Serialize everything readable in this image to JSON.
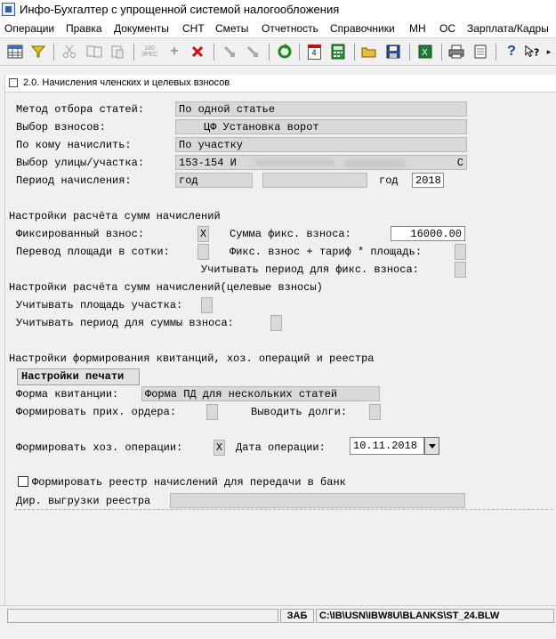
{
  "window": {
    "title": "Инфо-Бухгалтер с упрощенной системой налогообложения"
  },
  "menu": [
    "Операции",
    "Правка",
    "Документы",
    "СНТ",
    "Сметы",
    "Отчетность",
    "Справочники",
    "МН",
    "ОС",
    "Зарплата/Кадры"
  ],
  "toolbar_icons": [
    "grid-icon",
    "filter-icon",
    "cut-icon",
    "copy-icon",
    "paste-icon",
    "calc-icon",
    "add-icon",
    "delete-icon",
    "tool-icon",
    "tool2-icon",
    "refresh-icon",
    "calendar-icon",
    "calculator-icon",
    "open-folder-icon",
    "save-icon",
    "excel-icon",
    "print-icon",
    "preview-icon",
    "help-icon",
    "context-help-icon"
  ],
  "toolbar": {
    "calendar_text": "4",
    "tb_180": "180"
  },
  "form": {
    "header": "2.0. Начисления членских и целевых взносов",
    "method_label": "Метод отбора статей:",
    "method_value": "По одной статье",
    "fees_label": "Выбор взносов:",
    "fees_value": "ЦФ Установка ворот",
    "whom_label": "По кому начислить:",
    "whom_value": "По участку",
    "street_label": "Выбор улицы/участка:",
    "street_value_start": "153-154 И",
    "street_value_end": "С",
    "period_label": "Период начисления:",
    "period_value": "год",
    "period_extra": "",
    "year_label": "год",
    "year_value": "2018",
    "section1": "Настройки расчёта сумм начислений",
    "fixed_label": "Фиксированный взнос:",
    "fixed_check": "X",
    "fixed_sum_label": "Сумма фикс. взноса:",
    "fixed_sum_value": "16000.00",
    "convert_label": "Перевод площади в сотки:",
    "convert_check": "",
    "fixed_tariff_label": "Фикс. взнос + тариф * площадь:",
    "fixed_tariff_check": "",
    "period_fixed_label": "Учитывать период для фикс. взноса:",
    "period_fixed_check": "",
    "section2": "Настройки расчёта сумм начислений(целевые взносы)",
    "area_label": "Учитывать площадь участка:",
    "area_check": "",
    "period_sum_label": "Учитывать период для суммы взноса:",
    "period_sum_check": "",
    "section3": "Настройки формирования квитанций, хоз. операций и реестра",
    "print_button": "Настройки печати",
    "receipt_label": "Форма квитанции:",
    "receipt_value": "Форма ПД для нескольких статей",
    "orders_label": "Формировать прих. ордера:",
    "orders_check": "",
    "debts_label": "Выводить долги:",
    "debts_check": "",
    "ops_label": "Формировать хоз. операции:",
    "ops_check": "X",
    "date_label": "Дата операции:",
    "date_value": "10.11.2018",
    "registry_label": "Формировать реестр начислений для передачи в банк",
    "dir_label": "Дир. выгрузки реестра",
    "dir_value": ""
  },
  "status": {
    "left": "",
    "mode": "ЗАБ",
    "path": "C:\\IB\\USN\\IBW8U\\BLANKS\\ST_24.BLW"
  }
}
